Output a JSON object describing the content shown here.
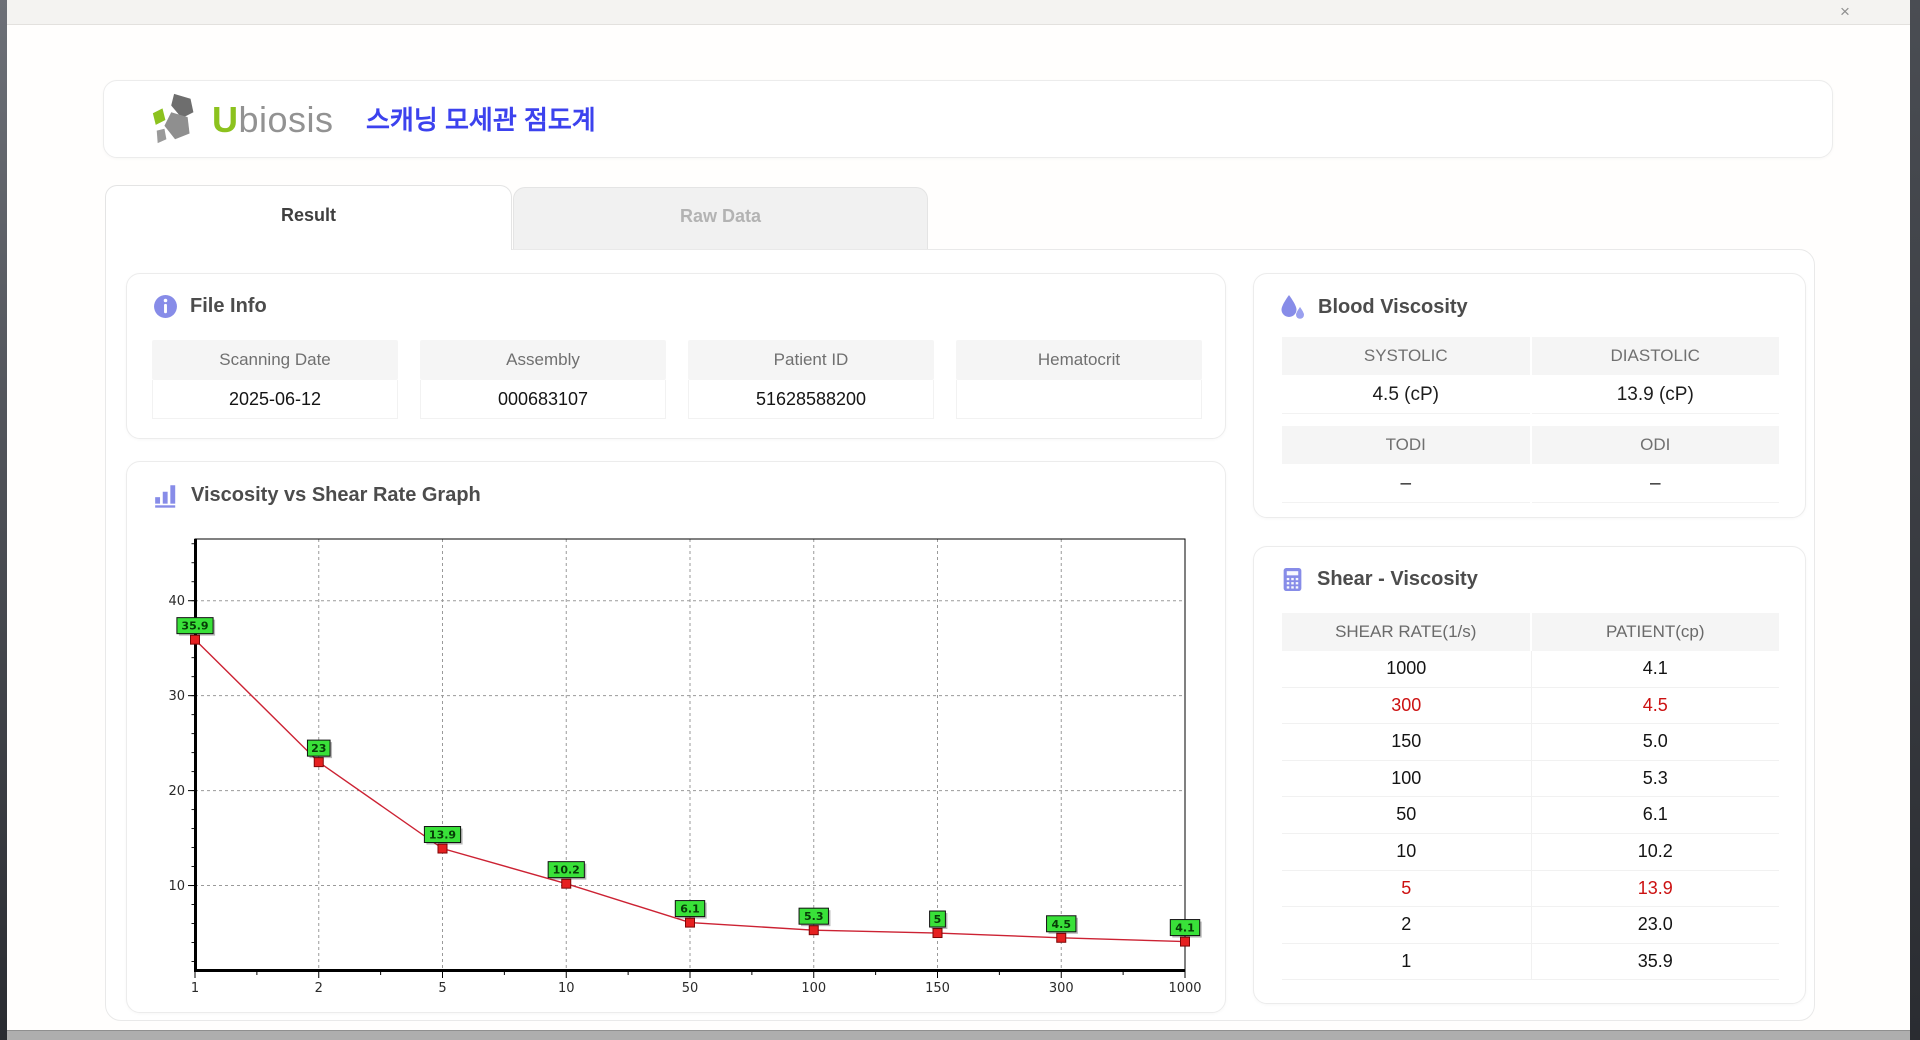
{
  "window": {
    "close_glyph": "×"
  },
  "header": {
    "brand_first_letter": "U",
    "brand_rest": "biosis",
    "app_title_korean": "스캐닝 모세관 점도계"
  },
  "tabs": [
    {
      "label": "Result",
      "active": true
    },
    {
      "label": "Raw Data",
      "active": false
    }
  ],
  "file_info": {
    "title": "File Info",
    "fields": [
      {
        "label": "Scanning Date",
        "value": "2025-06-12"
      },
      {
        "label": "Assembly",
        "value": "000683107"
      },
      {
        "label": "Patient ID",
        "value": "51628588200"
      },
      {
        "label": "Hematocrit",
        "value": ""
      }
    ]
  },
  "graph_section": {
    "title": "Viscosity vs Shear Rate Graph"
  },
  "chart_data": {
    "type": "line",
    "title": "Viscosity vs Shear Rate Graph",
    "x_categories": [
      "1",
      "2",
      "5",
      "10",
      "50",
      "100",
      "150",
      "300",
      "1000"
    ],
    "values": [
      35.9,
      23,
      13.9,
      10.2,
      6.1,
      5.3,
      5,
      4.5,
      4.1
    ],
    "point_labels": [
      "35.9",
      "23",
      "13.9",
      "10.2",
      "6.1",
      "5.3",
      "5",
      "4.5",
      "4.1"
    ],
    "xlabel": "",
    "ylabel": "",
    "x_axis_scale": "categorical-equal-spacing",
    "y_ticks": [
      10,
      20,
      30,
      40
    ],
    "ylim": [
      1,
      46.5
    ],
    "grid": "dashed",
    "legend": "none",
    "line_color": "#cc2233",
    "marker_color": "#e62020",
    "marker_border": "#7d0606",
    "marker_shape": "square",
    "point_label_bg": "#39e139",
    "point_label_border": "#111111",
    "point_label_text_color": "#073c07"
  },
  "blood_viscosity": {
    "title": "Blood Viscosity",
    "groups": [
      [
        {
          "label": "SYSTOLIC",
          "value": "4.5 (cP)"
        },
        {
          "label": "DIASTOLIC",
          "value": "13.9 (cP)"
        }
      ],
      [
        {
          "label": "TODI",
          "value": "–"
        },
        {
          "label": "ODI",
          "value": "–"
        }
      ]
    ]
  },
  "shear_viscosity": {
    "title": "Shear - Viscosity",
    "columns": [
      "SHEAR RATE(1/s)",
      "PATIENT(cp)"
    ],
    "highlight_color": "#cc1111",
    "rows": [
      {
        "shear_rate": "1000",
        "patient": "4.1",
        "highlighted": false
      },
      {
        "shear_rate": "300",
        "patient": "4.5",
        "highlighted": true
      },
      {
        "shear_rate": "150",
        "patient": "5.0",
        "highlighted": false
      },
      {
        "shear_rate": "100",
        "patient": "5.3",
        "highlighted": false
      },
      {
        "shear_rate": "50",
        "patient": "6.1",
        "highlighted": false
      },
      {
        "shear_rate": "10",
        "patient": "10.2",
        "highlighted": false
      },
      {
        "shear_rate": "5",
        "patient": "13.9",
        "highlighted": true
      },
      {
        "shear_rate": "2",
        "patient": "23.0",
        "highlighted": false
      },
      {
        "shear_rate": "1",
        "patient": "35.9",
        "highlighted": false
      }
    ]
  }
}
